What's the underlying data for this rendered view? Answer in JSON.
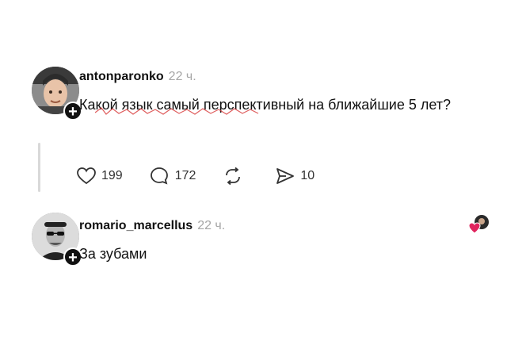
{
  "posts": [
    {
      "username": "antonparonko",
      "time": "22 ч.",
      "text": "Какой язык самый перспективный на ближайшие 5 лет?",
      "actions": {
        "likes": "199",
        "comments": "172",
        "shares": "10"
      }
    }
  ],
  "reply": {
    "username": "romario_marcellus",
    "time": "22 ч.",
    "text": "За зубами"
  },
  "icons": {
    "like": "heart-outline-icon",
    "comment": "speech-bubble-icon",
    "repost": "repost-arrows-icon",
    "share": "send-arrow-icon",
    "follow": "plus-icon",
    "reaction": "heart-reaction-icon"
  },
  "colors": {
    "text": "#111111",
    "muted": "#a6a6a6",
    "badge": "#111111",
    "reaction_heart": "#e0245e"
  }
}
